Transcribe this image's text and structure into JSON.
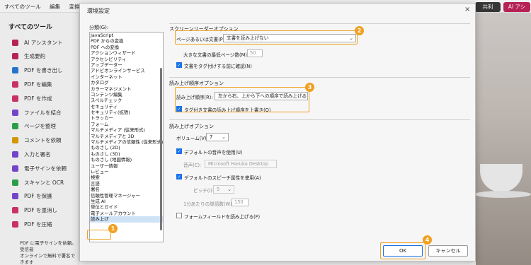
{
  "app": {
    "menu": [
      "すべてのツール",
      "編集",
      "変換"
    ],
    "share_button": "共利",
    "ai_button": "AI アシ",
    "tools_heading": "すべてのツール",
    "tools": [
      {
        "label": "AI アシスタント",
        "color": "#c2255c"
      },
      {
        "label": "生成要約",
        "color": "#c2255c"
      },
      {
        "label": "PDF を書き出し",
        "color": "#2b7bd6"
      },
      {
        "label": "PDF を編集",
        "color": "#d6336c"
      },
      {
        "label": "PDF を作成",
        "color": "#d6336c"
      },
      {
        "label": "ファイルを結合",
        "color": "#7b4bd6"
      },
      {
        "label": "ページを整理",
        "color": "#2fa84f"
      },
      {
        "label": "コメントを依頼",
        "color": "#e0a000"
      },
      {
        "label": "入力と署名",
        "color": "#7b4bd6"
      },
      {
        "label": "電子サインを依頼",
        "color": "#7b4bd6"
      },
      {
        "label": "スキャンと OCR",
        "color": "#2fa84f"
      },
      {
        "label": "PDF を保護",
        "color": "#7b4bd6"
      },
      {
        "label": "PDF を墨消し",
        "color": "#d6336c"
      },
      {
        "label": "PDF を圧縮",
        "color": "#d6336c"
      }
    ],
    "promo_line1": "PDF に電子サインを依頼。受信者",
    "promo_line2": "オンラインで無料で署名できます"
  },
  "dialog": {
    "title": "環境設定",
    "close": "×",
    "categories_label": "分類(G):",
    "categories": [
      "JavaScript",
      "PDF からの変換",
      "PDF への変換",
      "アクションウィザード",
      "アクセシビリティ",
      "アップデーター",
      "アドビオンラインサービス",
      "インターネット",
      "カタログ",
      "カラーマネジメント",
      "コンテンツ編集",
      "スペルチェック",
      "セキュリティ",
      "セキュリティ(拡張)",
      "トラッカー",
      "フォーム",
      "マルチメディア (従来形式)",
      "マルチメディアと 3D",
      "マルチメディアの信頼性 (従来形式)",
      "ものさし (2D)",
      "ものさし (3D)",
      "ものさし (地図情報)",
      "ユーザー情報",
      "レビュー",
      "検索",
      "言語",
      "署名",
      "信頼性管理マネージャー",
      "生成 AI",
      "単位とガイド",
      "電子メールアカウント",
      "読み上げ"
    ],
    "selected_category": "読み上げ",
    "screen_reader": {
      "title": "スクリーンリーダーオプション",
      "page_label": "ページあるいは文書(P):",
      "page_value": "文書を読み上げない",
      "min_pages_label": "大きな文書の最低ページ数(M):",
      "min_pages_value": "50",
      "confirm_label": "文書をタグ付けする前に確認(N)"
    },
    "reading_order": {
      "title": "読み上げ順序オプション",
      "order_label": "読み上げ順序(R):",
      "order_value": "左から右、上から下への順序で読み上げる",
      "override_label": "タグ付き文書の読み上げ順序を上書き(O)"
    },
    "read_out": {
      "title": "読み上げオプション",
      "volume_label": "ボリューム(V):",
      "volume_value": "7",
      "default_voice_label": "デフォルトの音声を使用(U)",
      "voice_label": "音声(C):",
      "voice_value": "Microsoft Haruka Desktop",
      "default_speech_label": "デフォルトのスピーチ属性を使用(A)",
      "pitch_label": "ピッチ(I):",
      "pitch_value": "5",
      "words_label": "1分あたりの単語数(W):",
      "words_value": "150",
      "form_fields_label": "フォームフィールドを読み上げる(F)"
    },
    "ok_button": "OK",
    "cancel_button": "キャンセル"
  },
  "markers": [
    "1",
    "2",
    "3",
    "4"
  ],
  "colors": {
    "highlight": "#f0a020",
    "accent": "#1a73e8"
  }
}
